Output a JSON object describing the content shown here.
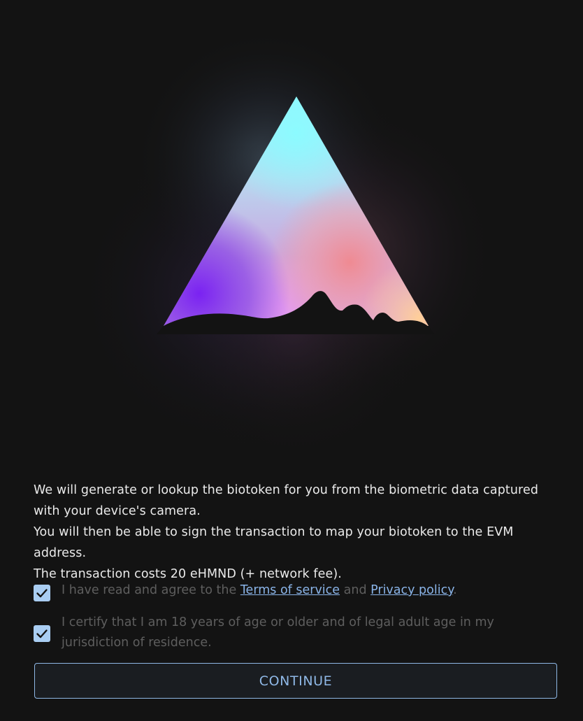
{
  "intro": {
    "line1": "We will generate or lookup the biotoken for you from the biometric data captured with your device's camera.",
    "line2": "You will then be able to sign the transaction to map your biotoken to the EVM address.",
    "line3": "The transaction costs 20 eHMND (+ network fee)."
  },
  "consent": {
    "terms_prefix": "I have read and agree to the ",
    "terms_link": "Terms of service",
    "terms_and": " and ",
    "privacy_link": "Privacy policy",
    "terms_suffix": ".",
    "terms_checked": true,
    "age_label": "I certify that I am 18 years of age or older and of legal adult age in my jurisdiction of residence.",
    "age_checked": true
  },
  "actions": {
    "continue_label": "CONTINUE"
  },
  "icons": {
    "logo": "gradient-triangle-logo-icon",
    "check": "check-icon"
  },
  "colors": {
    "background": "#131313",
    "accent": "#8fb8e6",
    "checkbox": "#a9cdf2",
    "muted_text": "#5e5e5e"
  }
}
